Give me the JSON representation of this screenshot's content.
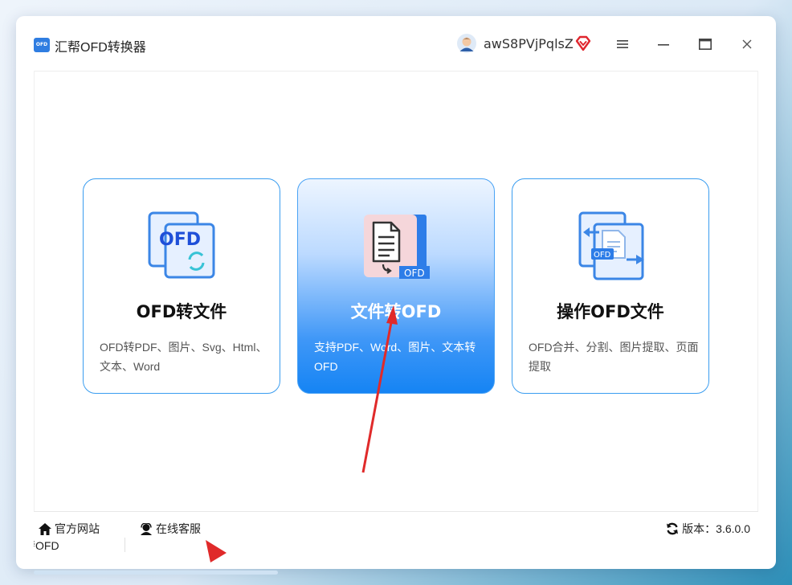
{
  "app": {
    "title": "汇帮OFD转换器",
    "logo_text": "OFD",
    "username": "awS8PVjPqlsZ",
    "accent": "#1584f4",
    "vip_color": "#e0262e"
  },
  "cards": [
    {
      "title": "OFD转文件",
      "desc": "OFD转PDF、图片、Svg、Html、文本、Word",
      "icon": "ofd-file-convert-icon",
      "icon_text": "OFD"
    },
    {
      "title": "文件转OFD",
      "desc": "支持PDF、Word、图片、文本转OFD",
      "icon": "document-to-ofd-icon",
      "icon_text": "OFD"
    },
    {
      "title": "操作OFD文件",
      "desc": "OFD合并、分割、图片提取、页面提取",
      "icon": "ofd-operate-icon",
      "icon_text": "OFD"
    }
  ],
  "footer": {
    "website_label": "官方网站",
    "service_label": "在线客服",
    "version_label": "版本：3.6.0.0",
    "cut_text": "转OFD"
  }
}
